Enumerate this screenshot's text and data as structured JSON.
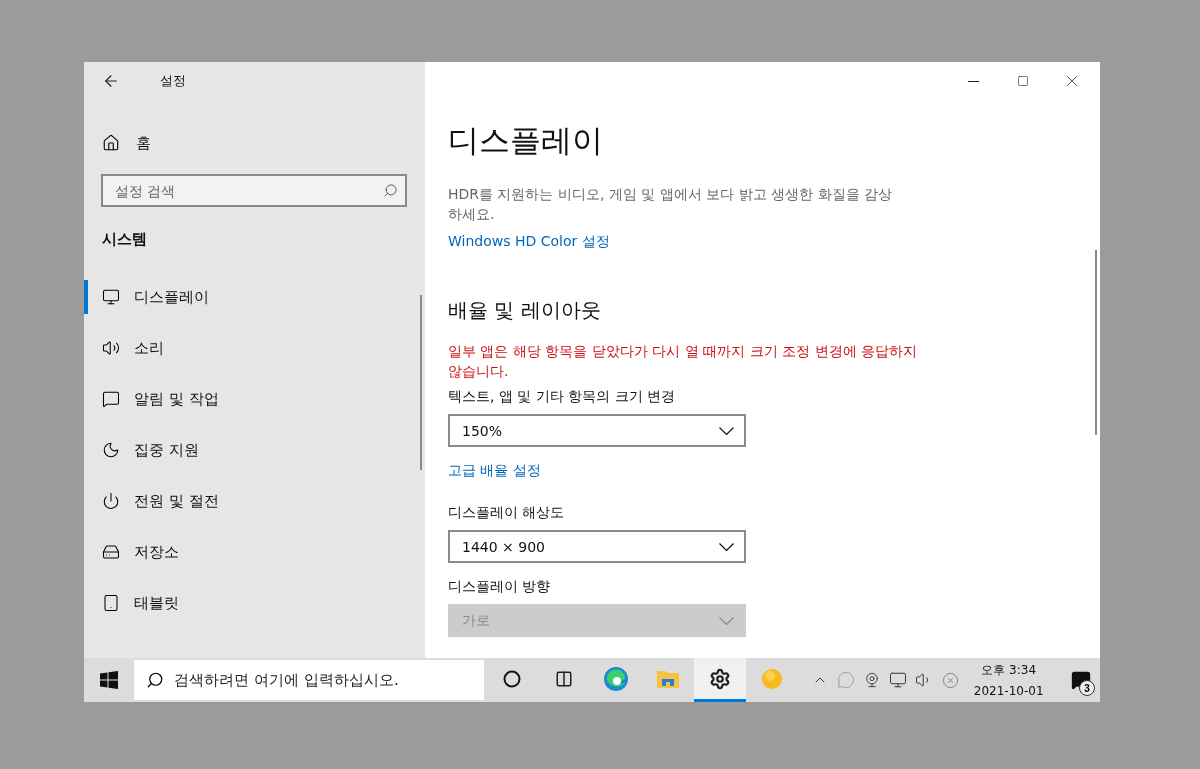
{
  "window": {
    "title": "설정"
  },
  "sidebar": {
    "home": "홈",
    "search": {
      "placeholder": "설정 검색"
    },
    "section": "시스템",
    "items": [
      {
        "label": "디스플레이",
        "selected": true
      },
      {
        "label": "소리",
        "selected": false
      },
      {
        "label": "알림 및 작업",
        "selected": false
      },
      {
        "label": "집중 지원",
        "selected": false
      },
      {
        "label": "전원 및 절전",
        "selected": false
      },
      {
        "label": "저장소",
        "selected": false
      },
      {
        "label": "태블릿",
        "selected": false
      }
    ]
  },
  "main": {
    "title": "디스플레이",
    "description": "HDR를 지원하는 비디오, 게임 및 앱에서 보다 밝고 생생한 화질을 감상하세요.",
    "hdr_link": "Windows HD Color 설정",
    "section_title": "배율 및 레이아웃",
    "warning": "일부 앱은 해당 항목을 닫았다가 다시 열 때까지 크기 조정 변경에 응답하지 않습니다.",
    "settings": [
      {
        "kind": "dropdown",
        "label": "텍스트, 앱 및 기타 항목의 크기 변경",
        "value": "150%",
        "disabled": false
      },
      {
        "kind": "link",
        "label": "고급 배율 설정"
      },
      {
        "kind": "dropdown",
        "label": "디스플레이 해상도",
        "value": "1440 × 900",
        "disabled": false
      },
      {
        "kind": "dropdown",
        "label": "디스플레이 방향",
        "value": "가로",
        "disabled": true
      }
    ]
  },
  "taskbar": {
    "search": {
      "placeholder": "검색하려면 여기에 입력하십시오."
    },
    "apps": [
      {
        "selected": false
      },
      {
        "selected": false
      },
      {
        "selected": false
      },
      {
        "selected": false
      },
      {
        "selected": true
      },
      {
        "selected": false
      }
    ],
    "time": "오후 3:34",
    "date": "2021-10-01",
    "notification_count": "3"
  }
}
